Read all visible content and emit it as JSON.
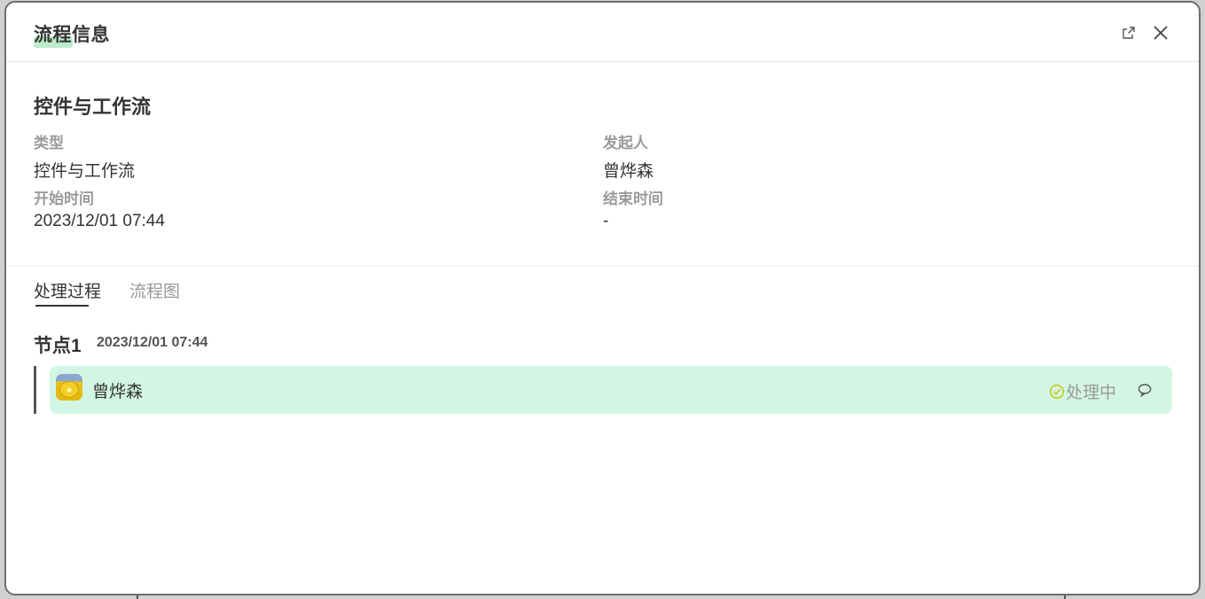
{
  "dialog": {
    "title": "流程信息",
    "open_external_icon": "external-link-icon",
    "close_icon": "close-icon"
  },
  "process": {
    "name": "控件与工作流",
    "fields": {
      "type_label": "类型",
      "type_value": "控件与工作流",
      "initiator_label": "发起人",
      "initiator_value": "曾烨森",
      "start_label": "开始时间",
      "start_value": "2023/12/01 07:44",
      "end_label": "结束时间",
      "end_value": "-"
    }
  },
  "tabs": {
    "items": [
      {
        "label": "处理过程",
        "active": true
      },
      {
        "label": "流程图",
        "active": false
      }
    ]
  },
  "node": {
    "title": "节点1",
    "time": "2023/12/01 07:44",
    "handler": {
      "name": "曾烨森",
      "status": "处理中",
      "status_icon": "check-circle-icon",
      "comment_icon": "comment-icon"
    }
  },
  "colors": {
    "handler_bg": "#d2f6e3",
    "status_icon": "#c8c81a",
    "title_highlight": "#bfeccd"
  }
}
